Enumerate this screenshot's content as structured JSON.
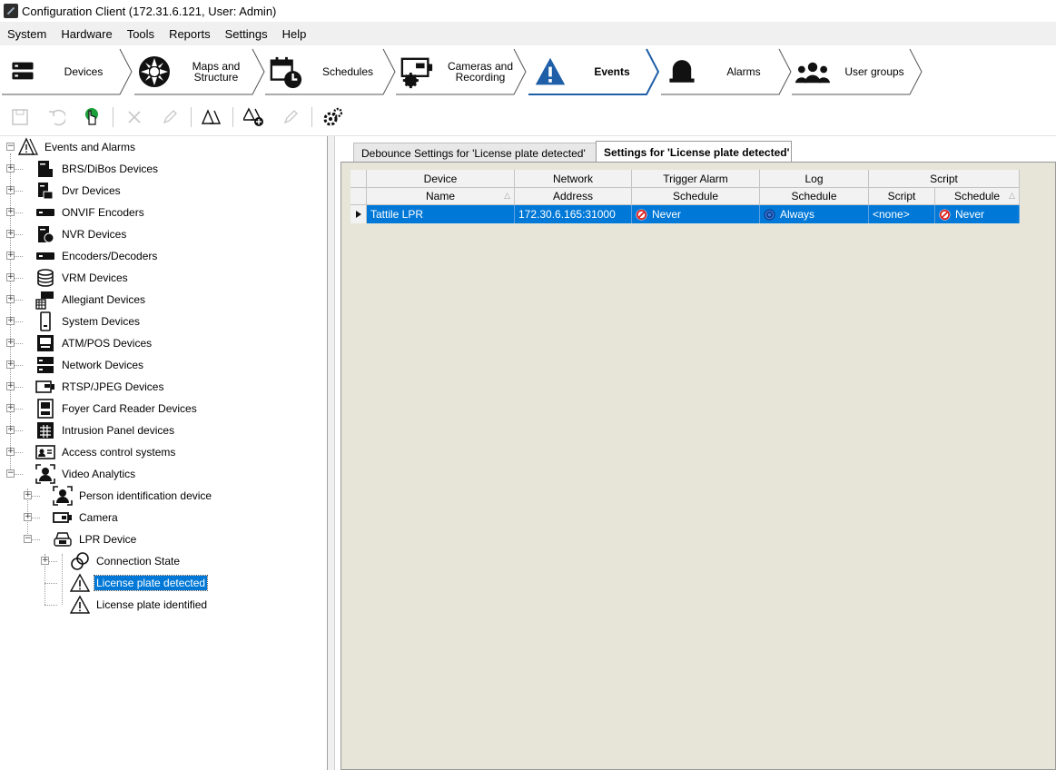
{
  "window": {
    "title": "Configuration Client (172.31.6.121, User: Admin)"
  },
  "menu": [
    "System",
    "Hardware",
    "Tools",
    "Reports",
    "Settings",
    "Help"
  ],
  "nav": [
    {
      "label_lines": [
        "Devices"
      ],
      "icon": "devices-icon",
      "active": false
    },
    {
      "label_lines": [
        "Maps and",
        "Structure"
      ],
      "icon": "maps-icon",
      "active": false
    },
    {
      "label_lines": [
        "Schedules"
      ],
      "icon": "schedules-icon",
      "active": false
    },
    {
      "label_lines": [
        "Cameras and",
        "Recording"
      ],
      "icon": "camera-recording-icon",
      "active": false
    },
    {
      "label_lines": [
        "Events"
      ],
      "icon": "events-warning-icon",
      "active": true
    },
    {
      "label_lines": [
        "Alarms"
      ],
      "icon": "alarm-bell-icon",
      "active": false
    },
    {
      "label_lines": [
        "User groups"
      ],
      "icon": "user-groups-icon",
      "active": false
    }
  ],
  "toolbar": [
    {
      "name": "save-icon",
      "enabled": false
    },
    {
      "name": "undo-icon",
      "enabled": false
    },
    {
      "name": "activate-icon",
      "enabled": true
    },
    {
      "name": "delete-icon",
      "enabled": false
    },
    {
      "name": "edit-icon",
      "enabled": false
    },
    {
      "name": "event-debounce-icon",
      "enabled": true
    },
    {
      "name": "add-compound-event-icon",
      "enabled": true
    },
    {
      "name": "edit-compound-event-icon",
      "enabled": false
    },
    {
      "name": "script-editor-icon",
      "enabled": true
    }
  ],
  "tree": {
    "root": "Events and Alarms",
    "items": [
      "BRS/DiBos Devices",
      "Dvr Devices",
      "ONVIF Encoders",
      "NVR Devices",
      "Encoders/Decoders",
      "VRM Devices",
      "Allegiant Devices",
      "System Devices",
      "ATM/POS Devices",
      "Network Devices",
      "RTSP/JPEG Devices",
      "Foyer Card Reader Devices",
      "Intrusion Panel devices",
      "Access control systems",
      "Video Analytics"
    ],
    "video_analytics_children": [
      "Person identification device",
      "Camera",
      "LPR Device"
    ],
    "lpr_children": [
      "Connection State",
      "License plate detected",
      "License plate identified"
    ],
    "selected": "License plate detected"
  },
  "tabs": [
    {
      "label": "Debounce Settings for 'License plate detected'",
      "active": false
    },
    {
      "label": "Settings for 'License plate detected'",
      "active": true
    }
  ],
  "grid": {
    "group_headers": [
      "Device",
      "Network",
      "Trigger Alarm",
      "Log",
      "Script"
    ],
    "columns": [
      "Name",
      "Address",
      "Schedule",
      "Schedule",
      "Script",
      "Schedule"
    ],
    "rows": [
      {
        "name": "Tattile LPR",
        "address": "172.30.6.165:31000",
        "trigger_schedule": "Never",
        "log_schedule": "Always",
        "script": "<none>",
        "script_schedule": "Never"
      }
    ]
  },
  "colors": {
    "selection": "#0078d7",
    "events_accent": "#1f5fa8",
    "panel": "#e6e5d8"
  }
}
